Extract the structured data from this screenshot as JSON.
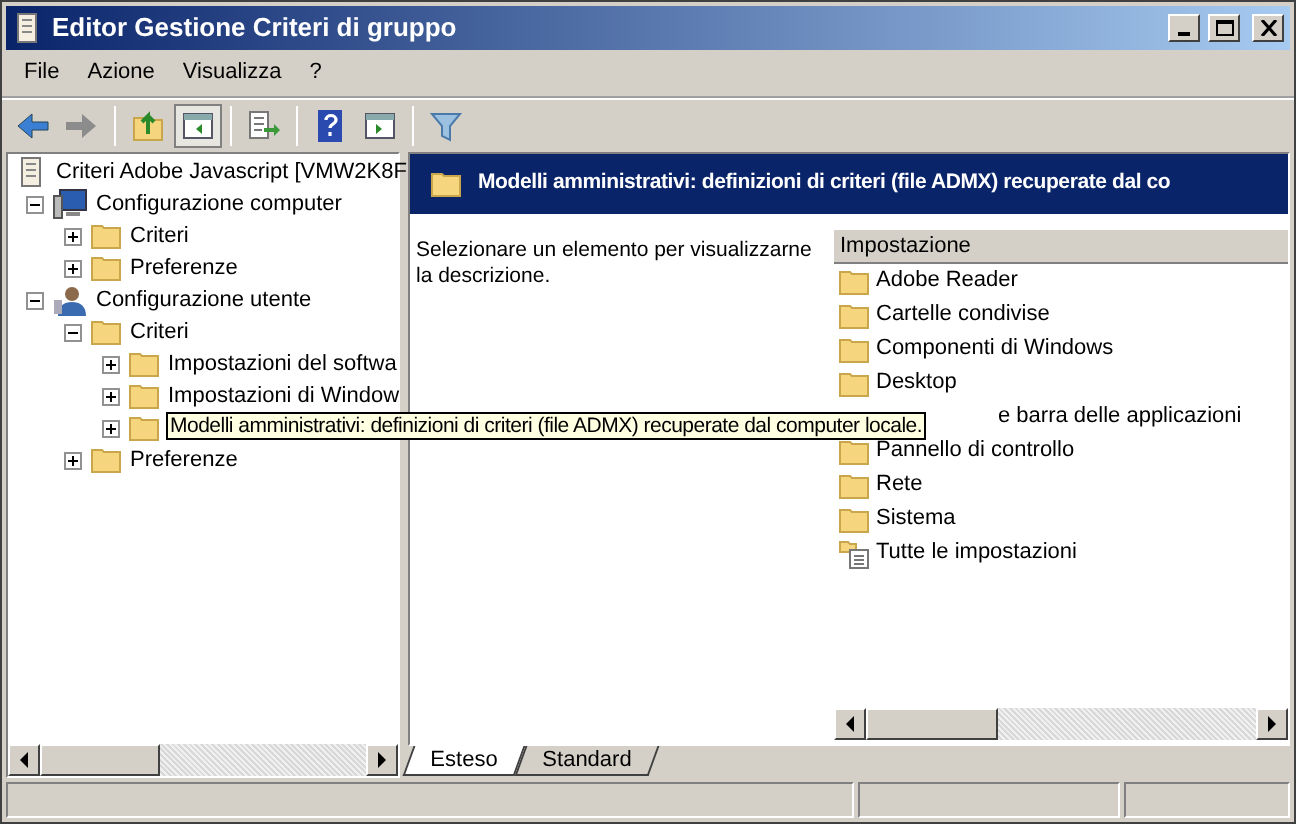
{
  "window": {
    "title": "Editor Gestione Criteri di gruppo"
  },
  "menu": [
    "File",
    "Azione",
    "Visualizza",
    "?"
  ],
  "toolbar": [
    {
      "kind": "back",
      "disabled": false
    },
    {
      "kind": "forward",
      "disabled": true
    },
    {
      "kind": "sep"
    },
    {
      "kind": "up"
    },
    {
      "kind": "tree",
      "selected": true
    },
    {
      "kind": "sep"
    },
    {
      "kind": "export"
    },
    {
      "kind": "sep"
    },
    {
      "kind": "help"
    },
    {
      "kind": "view"
    },
    {
      "kind": "sep"
    },
    {
      "kind": "filter"
    }
  ],
  "tree": {
    "label": "Criteri Adobe Javascript [VMW2K8F",
    "kind": "document",
    "children": [
      {
        "label": "Configurazione computer",
        "kind": "computer",
        "expanded": true,
        "children": [
          {
            "label": "Criteri",
            "kind": "folder",
            "expanded": false
          },
          {
            "label": "Preferenze",
            "kind": "folder",
            "expanded": false
          }
        ]
      },
      {
        "label": "Configurazione utente",
        "kind": "user",
        "expanded": true,
        "children": [
          {
            "label": "Criteri",
            "kind": "folder",
            "expanded": true,
            "children": [
              {
                "label": "Impostazioni del softwa",
                "kind": "folder",
                "expanded": false
              },
              {
                "label": "Impostazioni di Window",
                "kind": "folder",
                "expanded": false
              },
              {
                "label": "Modelli amministrativi: definizioni di criteri (file ADMX) recuperate dal computer locale.",
                "kind": "popup",
                "expanded": false
              }
            ]
          },
          {
            "label": "Preferenze",
            "kind": "folder",
            "expanded": false
          }
        ]
      }
    ]
  },
  "header": {
    "title": "Modelli amministrativi: definizioni di criteri (file ADMX) recuperate dal co"
  },
  "description": "Selezionare un elemento per visualizzarne la descrizione.",
  "list": {
    "column": "Impostazione",
    "items": [
      {
        "label": "Adobe Reader",
        "kind": "folder"
      },
      {
        "label": "Cartelle condivise",
        "kind": "folder"
      },
      {
        "label": "Componenti di Windows",
        "kind": "folder"
      },
      {
        "label": "Desktop",
        "kind": "folder"
      },
      {
        "label": "e barra delle applicazioni",
        "kind": "covered"
      },
      {
        "label": "Pannello di controllo",
        "kind": "folder"
      },
      {
        "label": "Rete",
        "kind": "folder"
      },
      {
        "label": "Sistema",
        "kind": "folder"
      },
      {
        "label": "Tutte le impostazioni",
        "kind": "settings"
      }
    ]
  },
  "tabs": [
    {
      "label": "Esteso",
      "selected": true
    },
    {
      "label": "Standard",
      "selected": false
    }
  ]
}
